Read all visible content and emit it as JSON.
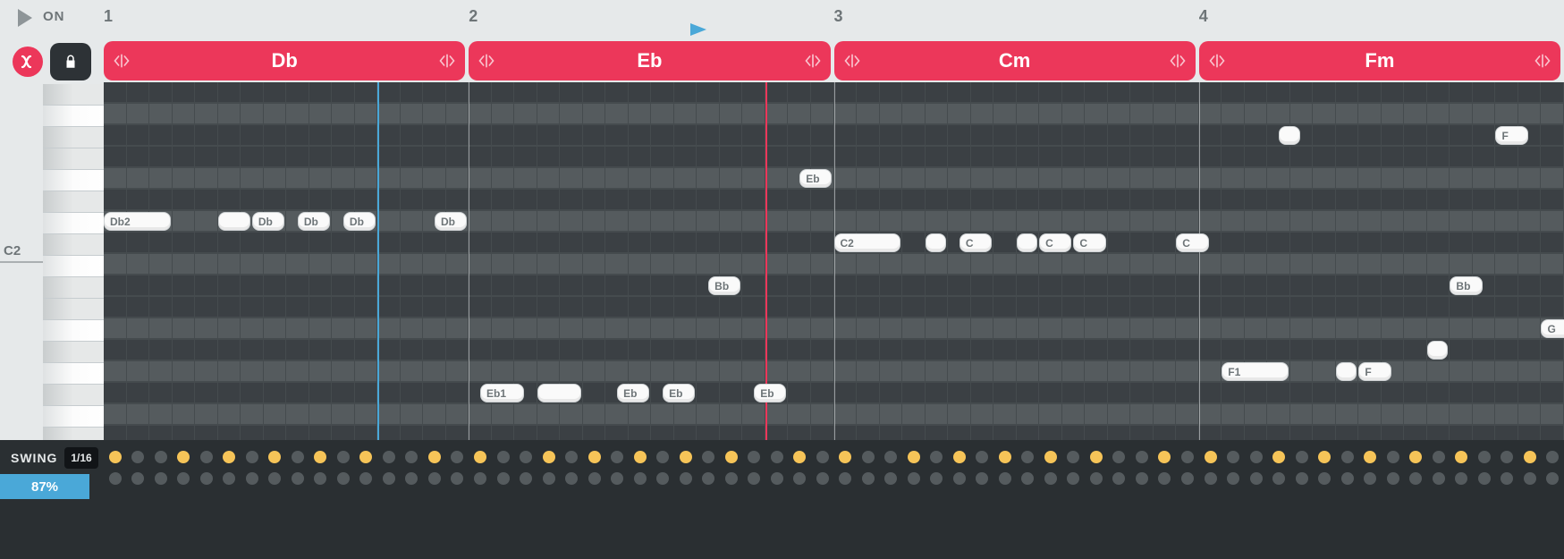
{
  "transport": {
    "on_label": "ON",
    "bars": [
      "1",
      "2",
      "3",
      "4"
    ],
    "playhead_bar": 2,
    "playhead_frac": 0.63
  },
  "chords": [
    {
      "label": "Db"
    },
    {
      "label": "Eb"
    },
    {
      "label": "Cm"
    },
    {
      "label": "Fm"
    }
  ],
  "piano_c_label": "C2",
  "grid": {
    "rows": 17,
    "steps_per_bar": 16,
    "bars": 4,
    "dark_rows": [
      0,
      2,
      3,
      5,
      7,
      9,
      10,
      12,
      14,
      16
    ],
    "blue_line_step": 12,
    "red_line_step": 29
  },
  "notes": [
    {
      "row": 6,
      "step": 0,
      "len": 3,
      "label": "Db2"
    },
    {
      "row": 6,
      "step": 5,
      "len": 1.5,
      "label": ""
    },
    {
      "row": 6,
      "step": 6.5,
      "len": 1.5,
      "label": "Db"
    },
    {
      "row": 6,
      "step": 8.5,
      "len": 1.5,
      "label": "Db"
    },
    {
      "row": 6,
      "step": 10.5,
      "len": 1.5,
      "label": "Db"
    },
    {
      "row": 6,
      "step": 14.5,
      "len": 1.5,
      "label": "Db"
    },
    {
      "row": 4,
      "step": 30.5,
      "len": 1.5,
      "label": "Eb"
    },
    {
      "row": 7,
      "step": 32,
      "len": 3,
      "label": "C2"
    },
    {
      "row": 7,
      "step": 36,
      "len": 1,
      "label": ""
    },
    {
      "row": 7,
      "step": 37.5,
      "len": 1.5,
      "label": "C"
    },
    {
      "row": 7,
      "step": 40,
      "len": 1,
      "label": ""
    },
    {
      "row": 7,
      "step": 41,
      "len": 1.5,
      "label": "C"
    },
    {
      "row": 7,
      "step": 42.5,
      "len": 1.5,
      "label": "C"
    },
    {
      "row": 7,
      "step": 47,
      "len": 1.5,
      "label": "C"
    },
    {
      "row": 9,
      "step": 26.5,
      "len": 1.5,
      "label": "Bb"
    },
    {
      "row": 14,
      "step": 16.5,
      "len": 2,
      "label": "Eb1"
    },
    {
      "row": 14,
      "step": 19,
      "len": 2,
      "label": ""
    },
    {
      "row": 14,
      "step": 22.5,
      "len": 1.5,
      "label": "Eb"
    },
    {
      "row": 14,
      "step": 24.5,
      "len": 1.5,
      "label": "Eb"
    },
    {
      "row": 14,
      "step": 28.5,
      "len": 1.5,
      "label": "Eb"
    },
    {
      "row": 2,
      "step": 51.5,
      "len": 1,
      "label": ""
    },
    {
      "row": 13,
      "step": 49,
      "len": 3,
      "label": "F1"
    },
    {
      "row": 13,
      "step": 54,
      "len": 1,
      "label": ""
    },
    {
      "row": 13,
      "step": 55,
      "len": 1.5,
      "label": "F"
    },
    {
      "row": 12,
      "step": 58,
      "len": 1,
      "label": ""
    },
    {
      "row": 9,
      "step": 59,
      "len": 1.5,
      "label": "Bb"
    },
    {
      "row": 2,
      "step": 61,
      "len": 1.5,
      "label": "F"
    },
    {
      "row": 11,
      "step": 63,
      "len": 1.5,
      "label": "G"
    }
  ],
  "swing": {
    "label": "SWING",
    "division": "1/16",
    "percent": "87%",
    "row1_on": [
      0,
      3,
      5,
      7,
      9,
      11,
      14,
      16,
      19,
      21,
      23,
      25,
      27,
      30,
      32,
      35,
      37,
      39,
      41,
      43,
      46,
      48,
      51,
      53,
      55,
      57,
      59,
      62
    ],
    "row2_on": []
  }
}
